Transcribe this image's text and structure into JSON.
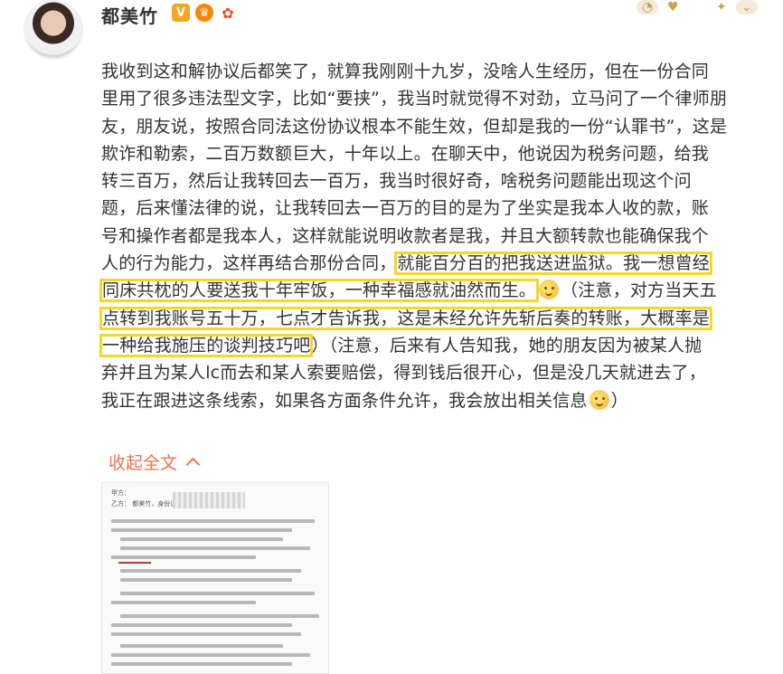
{
  "user": {
    "name": "都美竹",
    "verified_badge": "V"
  },
  "post": {
    "lines": [
      "我收到这和解协议后都笑了，就算我刚刚十九岁，没啥人生经历，但在一份合同",
      "里用了很多违法型文字，比如“要挟”，我当时就觉得不对劲，立马问了一个律师朋",
      "友，朋友说，按照合同法这份协议根本不能生效，但却是我的一份“认罪书”，这是",
      "欺诈和勒索，二百万数额巨大，十年以上。在聊天中，他说因为税务问题，给我",
      "转三百万，然后让我转回去一百万，我当时很好奇，啥税务问题能出现这个问",
      "题，后来懂法律的说，让我转回去一百万的目的是为了坐实是我本人收的款，账",
      "号和操作者都是我本人，这样就能说明收款者是我，并且大额转款也能确保我个"
    ],
    "line8_a": "人的行为能力，这样再结合那份合同，",
    "line8_hl": "就能百分百的把我送进监狱。我一想曾经",
    "line9_hl": "同床共枕的人要送我十年牢饭，一种幸福感就油然而生。",
    "line9_b": "（注意，对方当天五",
    "line10_hl": "点转到我账号五十万，七点才告诉我，这是未经允许先斩后奏的转账，大概率是",
    "line11_hl": "一种给我施压的谈判技巧吧",
    "line11_b": "）（注意，后来有人告知我，她的朋友因为被某人抛",
    "line12": "弃并且为某人lc而去和某人索要赔偿，得到钱后很开心，但是没几天就进去了，",
    "line13": "我正在跟进这条线索，如果各方面条件允许，我会放出相关信息",
    "line13_end": "）"
  },
  "collapse_label": "收起全文",
  "document_preview": {
    "header_a": "甲方：",
    "header_b": "乙方：  都美竹，身份证号"
  },
  "colors": {
    "highlight": "#f6d726",
    "link": "#eb7350",
    "text": "#333333"
  }
}
